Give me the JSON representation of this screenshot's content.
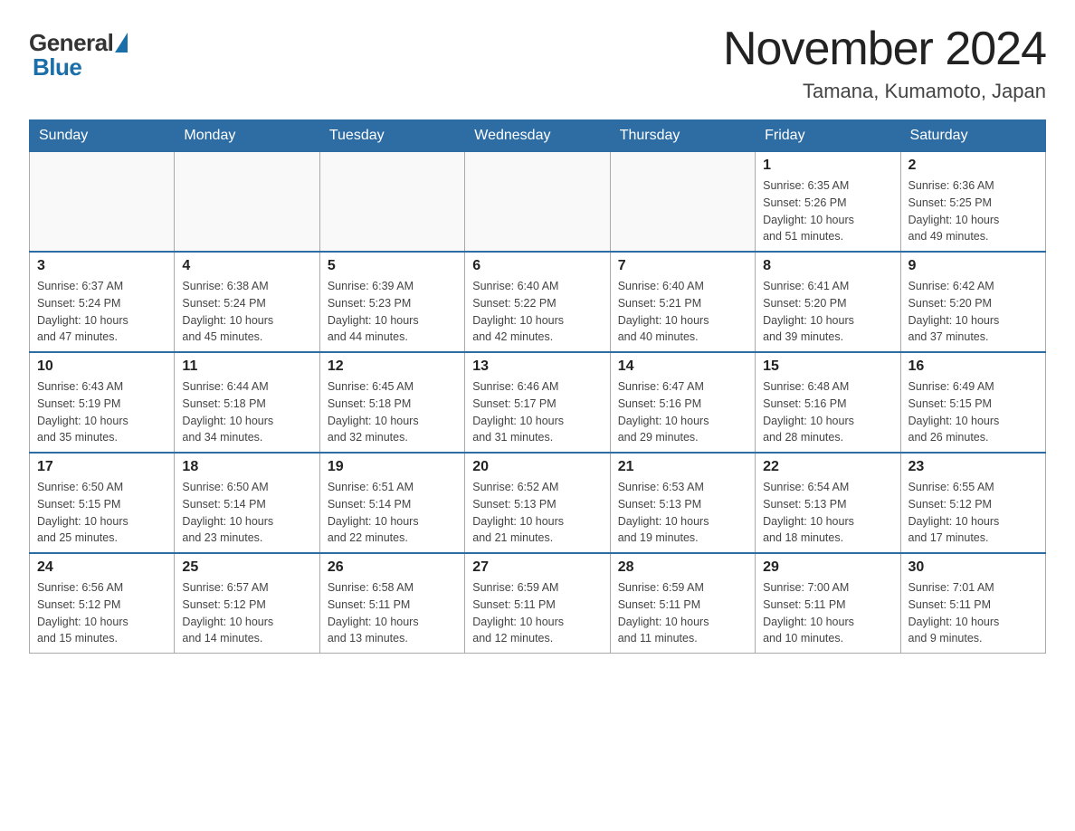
{
  "header": {
    "title": "November 2024",
    "location": "Tamana, Kumamoto, Japan",
    "logo_general": "General",
    "logo_blue": "Blue"
  },
  "days_header": [
    "Sunday",
    "Monday",
    "Tuesday",
    "Wednesday",
    "Thursday",
    "Friday",
    "Saturday"
  ],
  "weeks": [
    [
      {
        "day": "",
        "info": ""
      },
      {
        "day": "",
        "info": ""
      },
      {
        "day": "",
        "info": ""
      },
      {
        "day": "",
        "info": ""
      },
      {
        "day": "",
        "info": ""
      },
      {
        "day": "1",
        "info": "Sunrise: 6:35 AM\nSunset: 5:26 PM\nDaylight: 10 hours\nand 51 minutes."
      },
      {
        "day": "2",
        "info": "Sunrise: 6:36 AM\nSunset: 5:25 PM\nDaylight: 10 hours\nand 49 minutes."
      }
    ],
    [
      {
        "day": "3",
        "info": "Sunrise: 6:37 AM\nSunset: 5:24 PM\nDaylight: 10 hours\nand 47 minutes."
      },
      {
        "day": "4",
        "info": "Sunrise: 6:38 AM\nSunset: 5:24 PM\nDaylight: 10 hours\nand 45 minutes."
      },
      {
        "day": "5",
        "info": "Sunrise: 6:39 AM\nSunset: 5:23 PM\nDaylight: 10 hours\nand 44 minutes."
      },
      {
        "day": "6",
        "info": "Sunrise: 6:40 AM\nSunset: 5:22 PM\nDaylight: 10 hours\nand 42 minutes."
      },
      {
        "day": "7",
        "info": "Sunrise: 6:40 AM\nSunset: 5:21 PM\nDaylight: 10 hours\nand 40 minutes."
      },
      {
        "day": "8",
        "info": "Sunrise: 6:41 AM\nSunset: 5:20 PM\nDaylight: 10 hours\nand 39 minutes."
      },
      {
        "day": "9",
        "info": "Sunrise: 6:42 AM\nSunset: 5:20 PM\nDaylight: 10 hours\nand 37 minutes."
      }
    ],
    [
      {
        "day": "10",
        "info": "Sunrise: 6:43 AM\nSunset: 5:19 PM\nDaylight: 10 hours\nand 35 minutes."
      },
      {
        "day": "11",
        "info": "Sunrise: 6:44 AM\nSunset: 5:18 PM\nDaylight: 10 hours\nand 34 minutes."
      },
      {
        "day": "12",
        "info": "Sunrise: 6:45 AM\nSunset: 5:18 PM\nDaylight: 10 hours\nand 32 minutes."
      },
      {
        "day": "13",
        "info": "Sunrise: 6:46 AM\nSunset: 5:17 PM\nDaylight: 10 hours\nand 31 minutes."
      },
      {
        "day": "14",
        "info": "Sunrise: 6:47 AM\nSunset: 5:16 PM\nDaylight: 10 hours\nand 29 minutes."
      },
      {
        "day": "15",
        "info": "Sunrise: 6:48 AM\nSunset: 5:16 PM\nDaylight: 10 hours\nand 28 minutes."
      },
      {
        "day": "16",
        "info": "Sunrise: 6:49 AM\nSunset: 5:15 PM\nDaylight: 10 hours\nand 26 minutes."
      }
    ],
    [
      {
        "day": "17",
        "info": "Sunrise: 6:50 AM\nSunset: 5:15 PM\nDaylight: 10 hours\nand 25 minutes."
      },
      {
        "day": "18",
        "info": "Sunrise: 6:50 AM\nSunset: 5:14 PM\nDaylight: 10 hours\nand 23 minutes."
      },
      {
        "day": "19",
        "info": "Sunrise: 6:51 AM\nSunset: 5:14 PM\nDaylight: 10 hours\nand 22 minutes."
      },
      {
        "day": "20",
        "info": "Sunrise: 6:52 AM\nSunset: 5:13 PM\nDaylight: 10 hours\nand 21 minutes."
      },
      {
        "day": "21",
        "info": "Sunrise: 6:53 AM\nSunset: 5:13 PM\nDaylight: 10 hours\nand 19 minutes."
      },
      {
        "day": "22",
        "info": "Sunrise: 6:54 AM\nSunset: 5:13 PM\nDaylight: 10 hours\nand 18 minutes."
      },
      {
        "day": "23",
        "info": "Sunrise: 6:55 AM\nSunset: 5:12 PM\nDaylight: 10 hours\nand 17 minutes."
      }
    ],
    [
      {
        "day": "24",
        "info": "Sunrise: 6:56 AM\nSunset: 5:12 PM\nDaylight: 10 hours\nand 15 minutes."
      },
      {
        "day": "25",
        "info": "Sunrise: 6:57 AM\nSunset: 5:12 PM\nDaylight: 10 hours\nand 14 minutes."
      },
      {
        "day": "26",
        "info": "Sunrise: 6:58 AM\nSunset: 5:11 PM\nDaylight: 10 hours\nand 13 minutes."
      },
      {
        "day": "27",
        "info": "Sunrise: 6:59 AM\nSunset: 5:11 PM\nDaylight: 10 hours\nand 12 minutes."
      },
      {
        "day": "28",
        "info": "Sunrise: 6:59 AM\nSunset: 5:11 PM\nDaylight: 10 hours\nand 11 minutes."
      },
      {
        "day": "29",
        "info": "Sunrise: 7:00 AM\nSunset: 5:11 PM\nDaylight: 10 hours\nand 10 minutes."
      },
      {
        "day": "30",
        "info": "Sunrise: 7:01 AM\nSunset: 5:11 PM\nDaylight: 10 hours\nand 9 minutes."
      }
    ]
  ]
}
